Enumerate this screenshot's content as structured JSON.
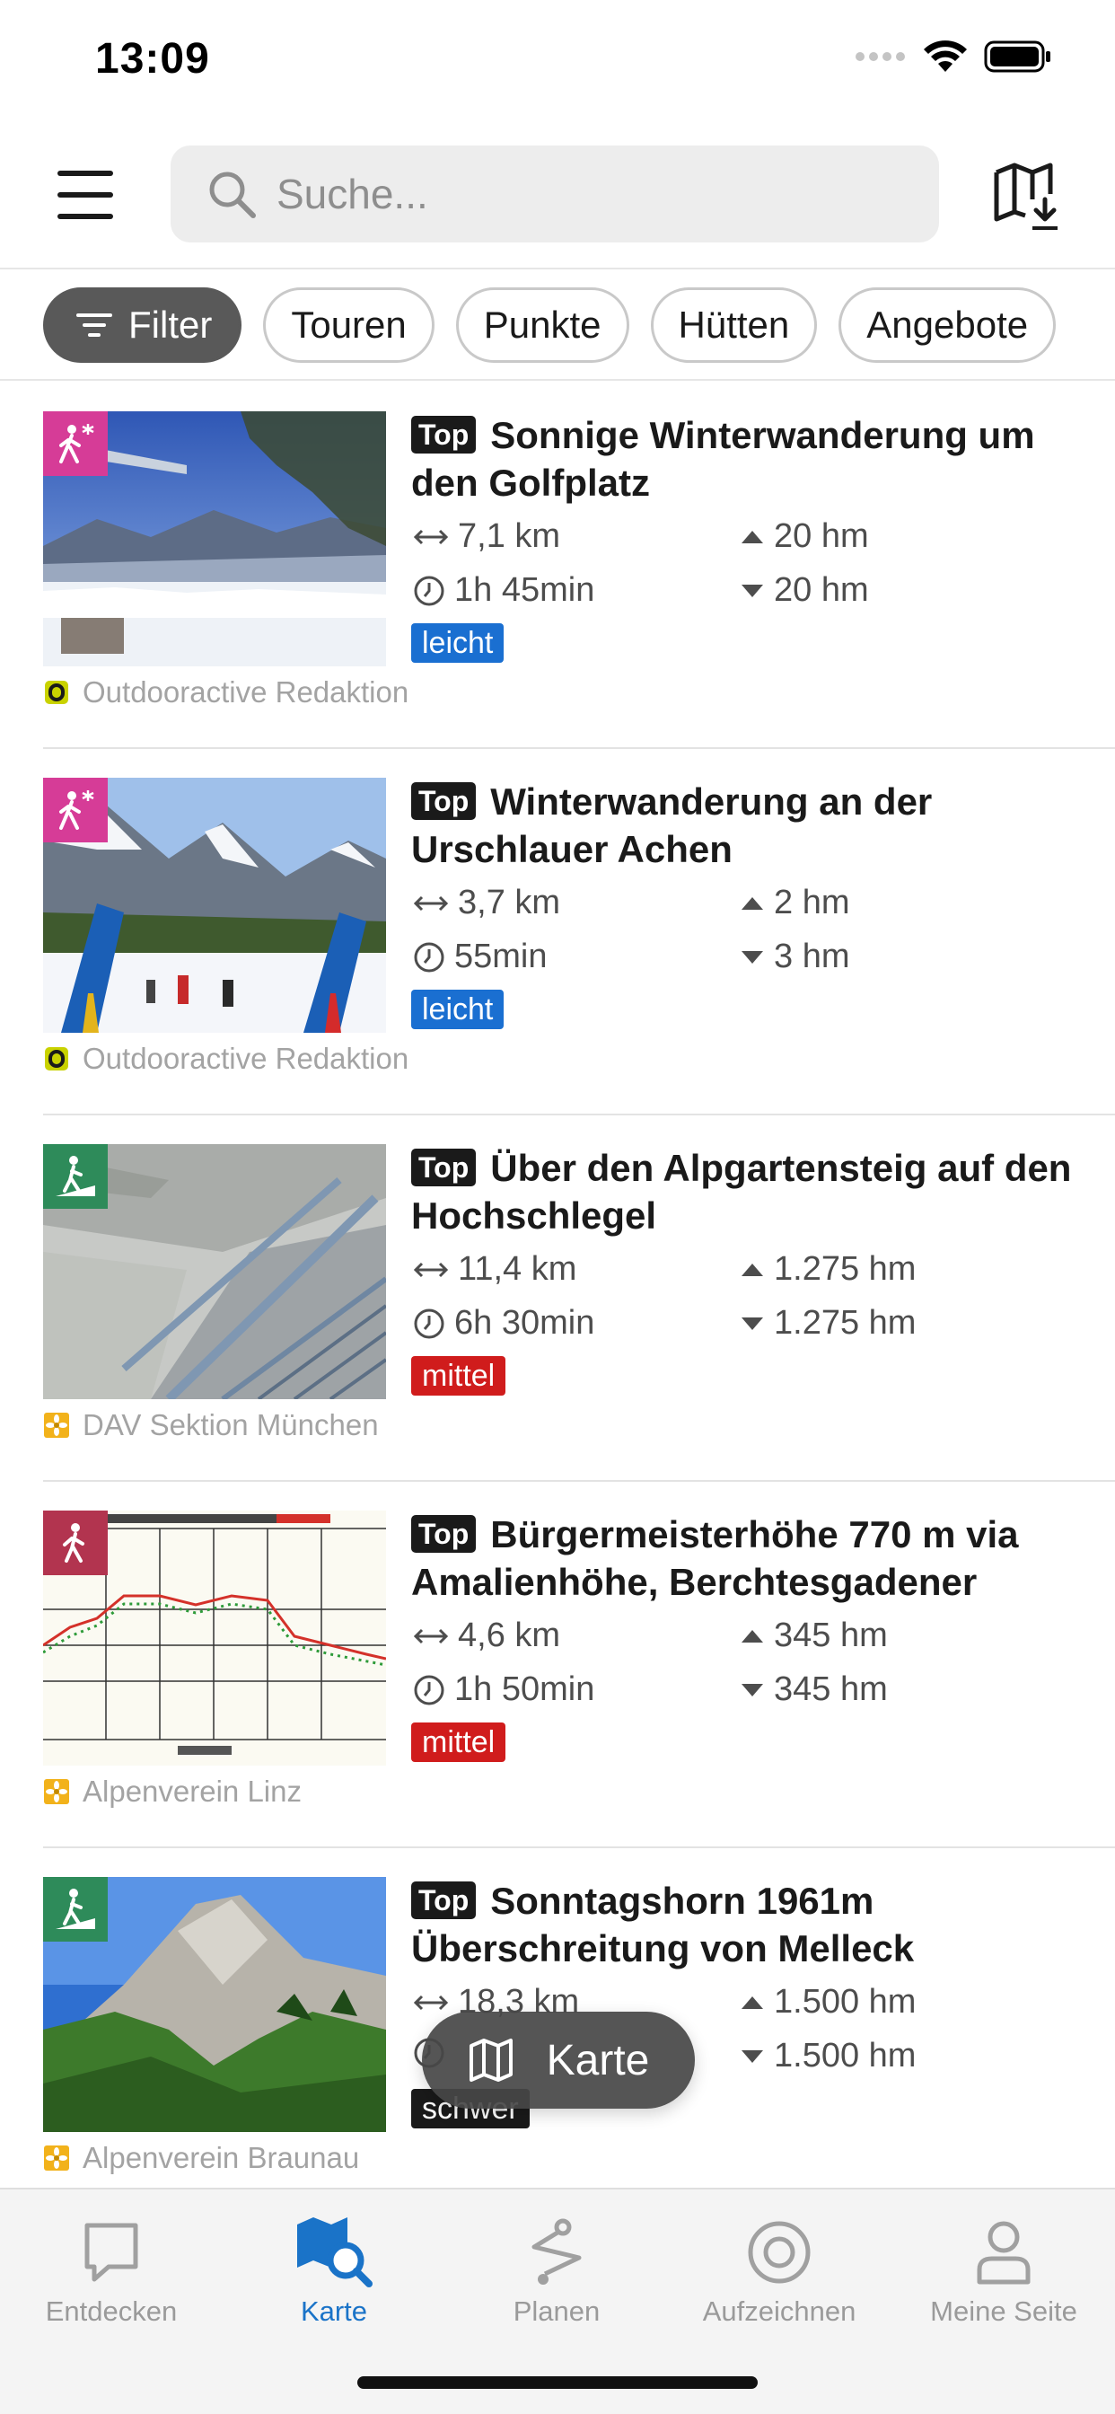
{
  "status_bar": {
    "time": "13:09"
  },
  "header": {
    "search_placeholder": "Suche..."
  },
  "chips": {
    "filter": "Filter",
    "items": [
      "Touren",
      "Punkte",
      "Hütten",
      "Angebote"
    ]
  },
  "tag_label": "Top",
  "colors": {
    "leicht": "#1a6fd1",
    "mittel": "#d01c1c",
    "schwer": "#1a1a1a",
    "winter": "#d63c97",
    "hiking": "#2e8b5a",
    "alpine": "#b2344f",
    "accent": "#1a73c8"
  },
  "tours": [
    {
      "title": "Sonnige Winterwanderung um den Golfplatz",
      "distance": "7,1 km",
      "duration": "1h 45min",
      "ascent": "20 hm",
      "descent": "20 hm",
      "difficulty": "leicht",
      "source": "Outdooractive Redaktion",
      "category_icon": "winter-hiking-icon"
    },
    {
      "title": "Winterwanderung an der Urschlauer Achen",
      "distance": "3,7 km",
      "duration": "55min",
      "ascent": "2 hm",
      "descent": "3 hm",
      "difficulty": "leicht",
      "source": "Outdooractive Redaktion",
      "category_icon": "winter-hiking-icon"
    },
    {
      "title": "Über den Alpgartensteig auf den Hochschlegel",
      "distance": "11,4 km",
      "duration": "6h 30min",
      "ascent": "1.275 hm",
      "descent": "1.275 hm",
      "difficulty": "mittel",
      "source": "DAV Sektion München",
      "category_icon": "mountain-hiking-icon"
    },
    {
      "title": "Bürgermeisterhöhe 770 m via Amalienhöhe, Berchtesgadener",
      "distance": "4,6 km",
      "duration": "1h 50min",
      "ascent": "345 hm",
      "descent": "345 hm",
      "difficulty": "mittel",
      "source": "Alpenverein Linz",
      "category_icon": "hiking-icon"
    },
    {
      "title": "Sonntagshorn 1961m Überschreitung von Melleck",
      "distance": "18,3 km",
      "duration": "",
      "ascent": "1.500 hm",
      "descent": "1.500 hm",
      "difficulty": "schwer",
      "source": "Alpenverein Braunau",
      "category_icon": "mountain-hiking-icon"
    }
  ],
  "fab": {
    "label": "Karte"
  },
  "tabbar": {
    "items": [
      "Entdecken",
      "Karte",
      "Planen",
      "Aufzeichnen",
      "Meine Seite"
    ],
    "active": "Karte"
  }
}
